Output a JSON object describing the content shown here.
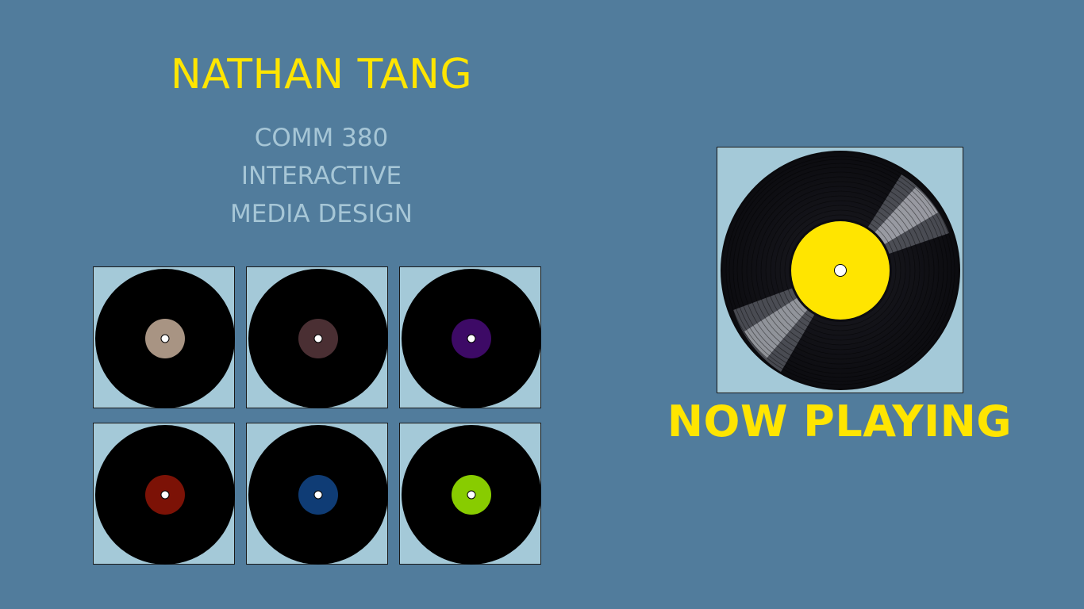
{
  "header": {
    "name": "NATHAN TANG",
    "course_lines": [
      "COMM 380",
      "INTERACTIVE",
      "MEDIA DESIGN"
    ]
  },
  "records": [
    {
      "label_color": "#a89483"
    },
    {
      "label_color": "#4a2f33"
    },
    {
      "label_color": "#3d0a66"
    },
    {
      "label_color": "#7c1206"
    },
    {
      "label_color": "#0f3c75"
    },
    {
      "label_color": "#88cc00"
    }
  ],
  "now_playing": {
    "label": "NOW PLAYING",
    "label_color": "#ffe500"
  },
  "colors": {
    "background": "#517c9c",
    "tile": "#a4c9d8",
    "accent": "#ffe500",
    "subtitle": "#a6c6d6"
  }
}
